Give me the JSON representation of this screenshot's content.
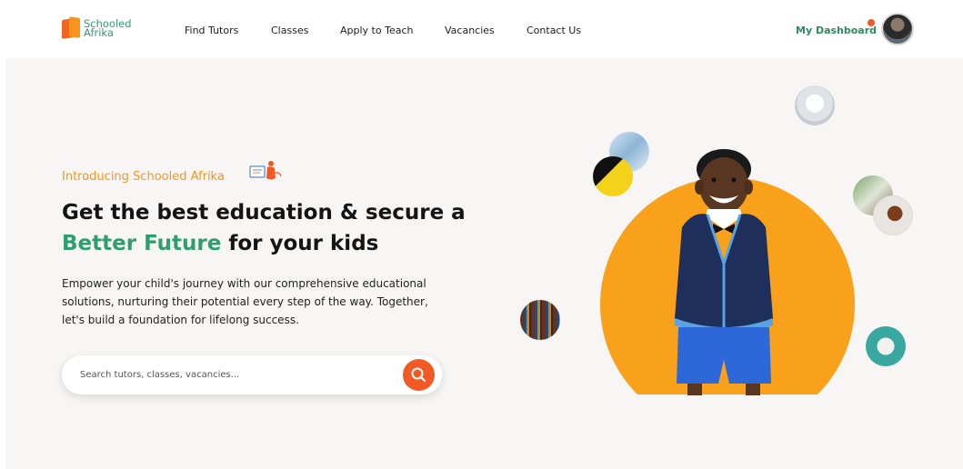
{
  "brand": {
    "line1": "Schooled",
    "line2": "Afrika",
    "color": "#2e9e6e",
    "mark_colors": [
      "#f26522",
      "#f7941d"
    ]
  },
  "nav": {
    "items": [
      {
        "label": "Find Tutors"
      },
      {
        "label": "Classes"
      },
      {
        "label": "Apply to Teach"
      },
      {
        "label": "Vacancies"
      },
      {
        "label": "Contact Us"
      }
    ],
    "dashboard_label": "My Dashboard",
    "notification_dot_color": "#f15a24"
  },
  "hero": {
    "intro": "Introducing Schooled Afrika",
    "headline_line1": "Get the best education & secure a",
    "headline_highlight": "Better Future",
    "headline_rest": " for your kids",
    "description": "Empower your child's journey with our comprehensive educational solutions, nurturing their potential every step of the way. Together, let's build a foundation for lifelong success."
  },
  "search": {
    "placeholder": "Search tutors, classes, vacancies..."
  },
  "colors": {
    "accent_orange": "#f15a24",
    "intro_orange": "#f7941d",
    "circle_orange": "#f9a11b",
    "green": "#2e9e6e",
    "background": "#f7f6f4"
  },
  "icons": [
    "search-icon",
    "book-reading-illustration",
    "avatar"
  ]
}
